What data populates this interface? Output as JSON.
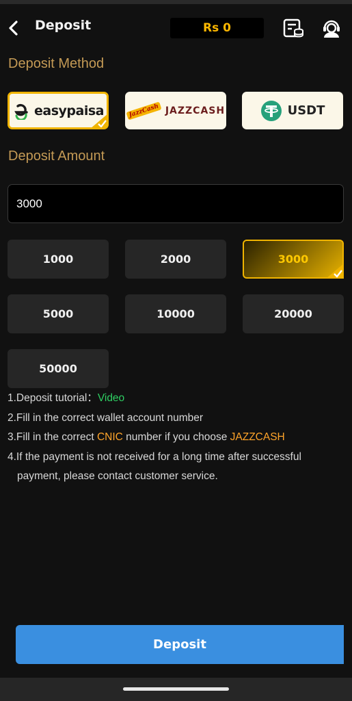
{
  "header": {
    "title": "Deposit",
    "balance": "Rs 0",
    "icons": [
      "back-icon",
      "wallet-records-icon",
      "customer-service-icon"
    ]
  },
  "method_section": {
    "label": "Deposit Method",
    "methods": [
      {
        "name": "easypaisa",
        "logo_text": "easypaisa",
        "selected": true
      },
      {
        "name": "JazzCash",
        "logo_text": "JAZZCASH",
        "logo_script": "JazzCash",
        "selected": false
      },
      {
        "name": "USDT",
        "logo_text": "USDT",
        "selected": false
      }
    ]
  },
  "amount_section": {
    "label": "Deposit Amount",
    "input_value": "3000",
    "options": [
      "1000",
      "2000",
      "3000",
      "5000",
      "10000",
      "20000",
      "50000"
    ],
    "selected": "3000"
  },
  "notes": {
    "line1_prefix": "1.Deposit tutorial：",
    "line1_link": "Video",
    "line2": "2.Fill in the correct wallet account number",
    "line3_prefix": "3.Fill in the correct ",
    "line3_highlight1": "CNIC",
    "line3_mid": " number if you choose ",
    "line3_highlight2": "JAZZCASH",
    "line4a": "4.If the payment is not received for a long time after successful",
    "line4b": "payment, please contact customer service."
  },
  "footer": {
    "deposit_label": "Deposit"
  },
  "colors": {
    "accent_gold": "#f0b400",
    "section_label": "#c49a55",
    "link_green": "#2fcf63",
    "highlight_orange": "#ffa42a",
    "button_blue": "#3a8fe0",
    "background": "#111111"
  }
}
